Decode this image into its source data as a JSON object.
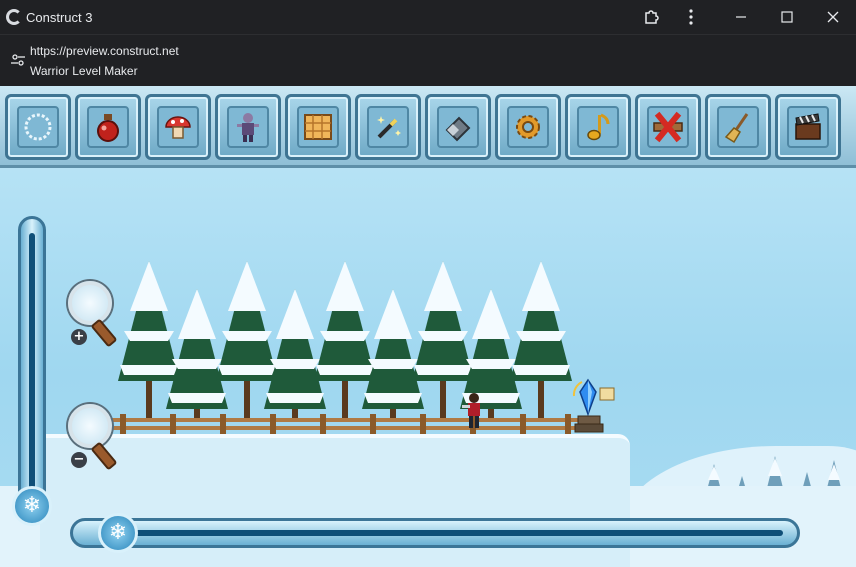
{
  "window": {
    "title": "Construct 3",
    "url": "https://preview.construct.net",
    "page_title": "Warrior Level Maker"
  },
  "toolbar": {
    "tools": [
      {
        "icon": "snow-frame-icon"
      },
      {
        "icon": "potion-icon"
      },
      {
        "icon": "mushroom-icon"
      },
      {
        "icon": "zombie-icon"
      },
      {
        "icon": "grid-map-icon"
      },
      {
        "icon": "magic-wand-icon"
      },
      {
        "icon": "eraser-icon"
      },
      {
        "icon": "gear-icon"
      },
      {
        "icon": "music-note-icon"
      },
      {
        "icon": "delete-cross-icon"
      },
      {
        "icon": "broom-icon"
      },
      {
        "icon": "clapperboard-icon"
      }
    ]
  },
  "controls": {
    "zoom_in_symbol": "+",
    "zoom_out_symbol": "−",
    "slider_knob_symbol": "❄"
  },
  "colors": {
    "sky": "#9fd7f0",
    "frame": "#3b7597",
    "snow": "#f4fbff",
    "titlebar": "#202124"
  }
}
